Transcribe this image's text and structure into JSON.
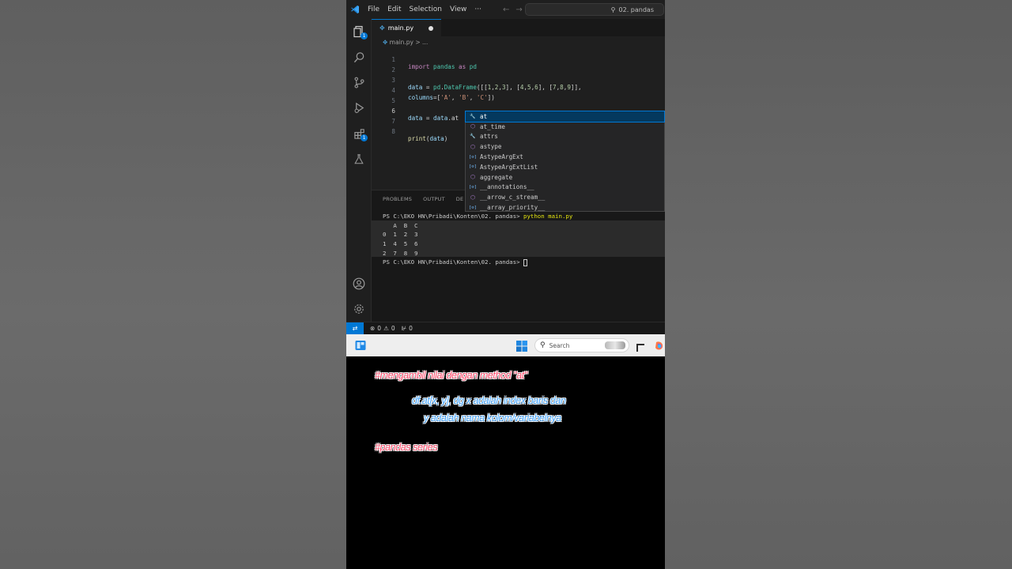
{
  "menu": {
    "items": [
      "File",
      "Edit",
      "Selection",
      "View",
      "···"
    ],
    "search_text": "02. pandas"
  },
  "activity": {
    "explorer_badge": "1",
    "extensions_badge": "1"
  },
  "tab": {
    "label": "main.py",
    "breadcrumb": "main.py > ..."
  },
  "editor": {
    "line_numbers": [
      "1",
      "2",
      "3",
      "4",
      "5",
      "6",
      "7",
      "8"
    ]
  },
  "suggestions": [
    {
      "label": "at",
      "kind": "tool",
      "selected": true
    },
    {
      "label": "at_time",
      "kind": "method",
      "selected": false
    },
    {
      "label": "attrs",
      "kind": "tool",
      "selected": false
    },
    {
      "label": "astype",
      "kind": "method",
      "selected": false
    },
    {
      "label": "AstypeArgExt",
      "kind": "field",
      "selected": false
    },
    {
      "label": "AstypeArgExtList",
      "kind": "field",
      "selected": false
    },
    {
      "label": "aggregate",
      "kind": "method",
      "selected": false
    },
    {
      "label": "__annotations__",
      "kind": "field",
      "selected": false
    },
    {
      "label": "__arrow_c_stream__",
      "kind": "method",
      "selected": false
    },
    {
      "label": "__array_priority__",
      "kind": "field",
      "selected": false
    }
  ],
  "panel": {
    "tabs": [
      "PROBLEMS",
      "OUTPUT",
      "DE"
    ]
  },
  "terminal": {
    "prompt": "PS C:\\EKO HN\\Pribadi\\Konten\\02. pandas>",
    "command": "python main.py",
    "output": [
      "   A  B  C",
      "0  1  2  3",
      "1  4  5  6",
      "2  7  8  9"
    ]
  },
  "status": {
    "errors": "0",
    "warnings": "0",
    "ports": "0"
  },
  "taskbar": {
    "search_placeholder": "Search"
  },
  "captions": {
    "line1": "#mengambil nilai dengan method \"at\"",
    "line2": "df.at[x, y], dg x adalah index baris dan",
    "line3": "y adalah nama kolom/variabelnya",
    "line4": "#pandas series"
  },
  "colors": {
    "accent": "#0078d4",
    "caption_red": "#ff4d6d",
    "caption_blue": "#4aa8ff"
  }
}
